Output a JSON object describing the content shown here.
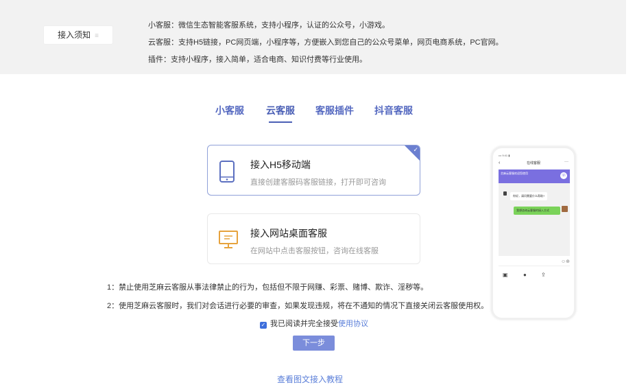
{
  "notice": {
    "tag_label": "接入须知",
    "tag_dots": "≡",
    "lines": [
      "小客服：微信生态智能客服系统，支持小程序，认证的公众号，小游戏。",
      "云客服：支持H5链接，PC网页端，小程序等，方便嵌入到您自己的公众号菜单，网页电商系统，PC官网。",
      "插件：支持小程序，接入简单，适合电商、知识付费等行业使用。"
    ]
  },
  "tabs": [
    "小客服",
    "云客服",
    "客服插件",
    "抖音客服"
  ],
  "active_tab": "云客服",
  "cards": [
    {
      "title": "接入H5移动端",
      "desc": "直接创建客服码客服链接，打开即可咨询",
      "icon": "mobile-icon",
      "selected": true
    },
    {
      "title": "接入网站桌面客服",
      "desc": "在网站中点击客服按钮，咨询在线客服",
      "icon": "desktop-icon",
      "selected": false
    }
  ],
  "rules": [
    "1：禁止使用芝麻云客服从事法律禁止的行为，包括但不限于网赚、彩票、赌博、欺诈、淫秽等。",
    "2：使用芝麻云客服时，我们对会话进行必要的审查，如果发现违规，将在不通知的情况下直接关闭云客服使用权。"
  ],
  "agreement": {
    "text": "我已阅读并完全接受",
    "link": "使用协议",
    "checked": true
  },
  "next_button": "下一步",
  "tutorial_link": "查看图文接入教程",
  "phone_preview": {
    "status": "••• 9:41 ▮",
    "header": "在线客服",
    "banner": "芝麻云客服欢迎您使用",
    "chat_in": "你好，请问需要什么帮助?",
    "chat_out": "我想咨询云客服的接入方式"
  },
  "colors": {
    "accent": "#4a5fb5",
    "button": "#7b8ddb",
    "link": "#5b7fd9",
    "notice_bg": "#f2f2f2"
  }
}
